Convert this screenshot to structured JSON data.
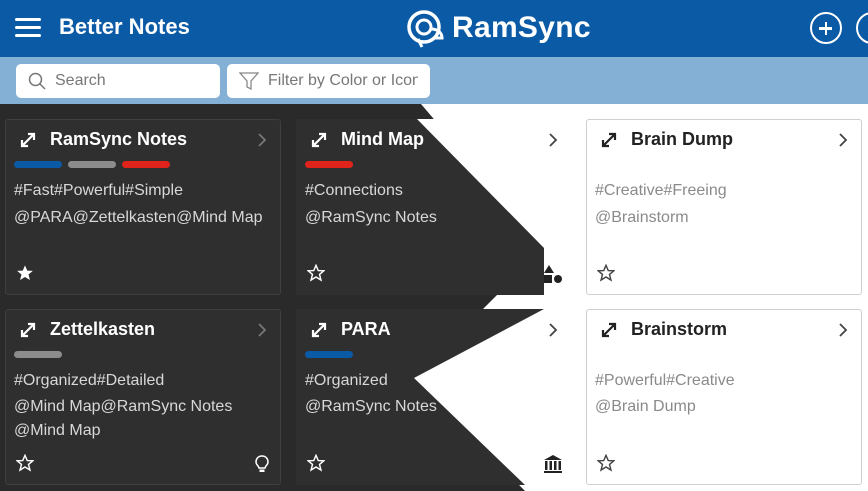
{
  "header": {
    "app_title": "Better Notes",
    "brand_name": "RamSync",
    "menu_icon": "hamburger-icon",
    "add_icon": "plus-circle-icon"
  },
  "toolbar": {
    "search_placeholder": "Search",
    "filter_placeholder": "Filter by Color or Icon"
  },
  "colors": {
    "header": "#0b5aa6",
    "toolbar": "#85b0d6",
    "dark_card": "#2f2f2f",
    "blue": "#0b5aa6",
    "gray": "#8c8c8c",
    "red": "#e0241b"
  },
  "cards": [
    {
      "title": "RamSync Notes",
      "tags": [
        "#0b5aa6",
        "#8c8c8c",
        "#e0241b"
      ],
      "lines": [
        "#Fast#Powerful#Simple",
        "@PARA@Zettelkasten@Mind Map"
      ],
      "starred": true,
      "icon": "none"
    },
    {
      "title": "Mind Map",
      "tags": [
        "#e0241b"
      ],
      "lines": [
        "#Connections",
        "@RamSync Notes"
      ],
      "starred": false,
      "icon": "shapes-icon"
    },
    {
      "title": "Brain Dump",
      "tags": [],
      "lines": [
        "#Creative#Freeing",
        "@Brainstorm"
      ],
      "starred": false,
      "icon": "none"
    },
    {
      "title": "Zettelkasten",
      "tags": [
        "#8c8c8c"
      ],
      "lines": [
        "#Organized#Detailed",
        "@Mind Map@RamSync Notes",
        "@Mind Map"
      ],
      "starred": false,
      "icon": "lightbulb-icon"
    },
    {
      "title": "PARA",
      "tags": [
        "#0b5aa6"
      ],
      "lines": [
        "#Organized",
        "@RamSync Notes"
      ],
      "starred": false,
      "icon": "bank-icon"
    },
    {
      "title": "Brainstorm",
      "tags": [],
      "lines": [
        "#Powerful#Creative",
        "@Brain Dump"
      ],
      "starred": false,
      "icon": "none"
    }
  ]
}
